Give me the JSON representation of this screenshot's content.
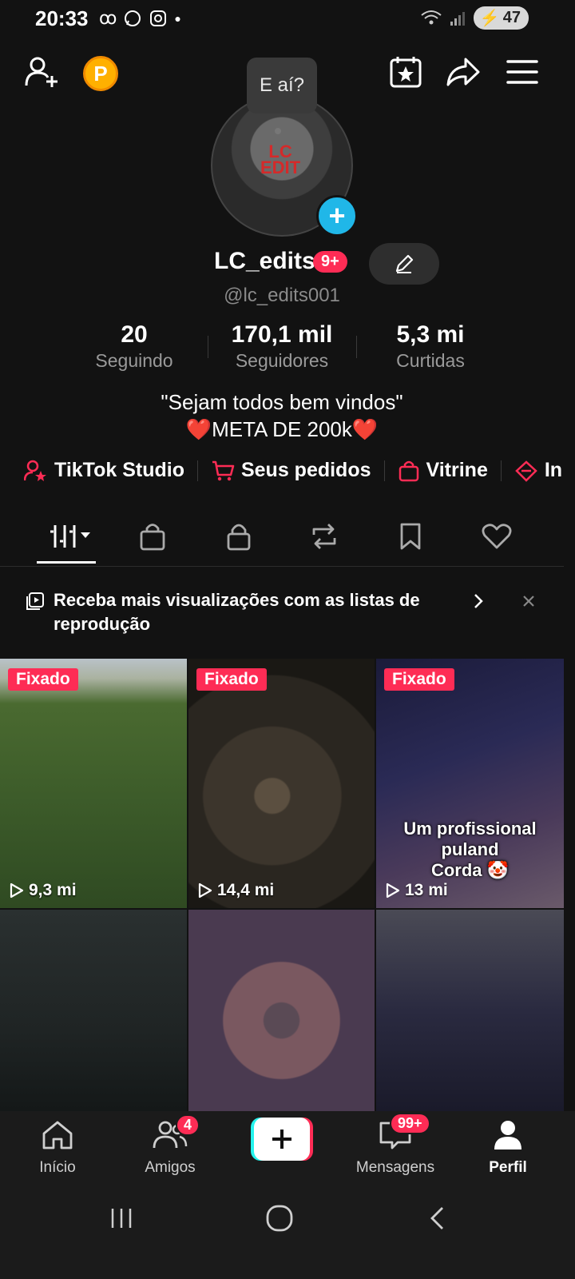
{
  "status": {
    "time": "20:33",
    "battery": "47"
  },
  "tooltip": "E aí?",
  "avatar": {
    "label_line1": "LC",
    "label_line2": "EDIT"
  },
  "profile": {
    "name": "LC_edits",
    "name_badge": "9+",
    "handle": "@lc_edits001"
  },
  "stats": [
    {
      "value": "20",
      "label": "Seguindo"
    },
    {
      "value": "170,1 mil",
      "label": "Seguidores"
    },
    {
      "value": "5,3 mi",
      "label": "Curtidas"
    }
  ],
  "bio": {
    "line1": "\"Sejam todos bem vindos\"",
    "line2": "❤️META DE 200k❤️"
  },
  "links": [
    {
      "label": "TikTok Studio",
      "icon": "person-star-icon"
    },
    {
      "label": "Seus pedidos",
      "icon": "cart-icon"
    },
    {
      "label": "Vitrine",
      "icon": "bag-icon"
    },
    {
      "label": "In",
      "icon": "gift-icon"
    }
  ],
  "banner": {
    "text": "Receba mais visualizações com as listas de reprodução"
  },
  "videos": [
    {
      "pinned": "Fixado",
      "views": "9,3 mi"
    },
    {
      "pinned": "Fixado",
      "views": "14,4 mi"
    },
    {
      "pinned": "Fixado",
      "views": "13 mi",
      "caption_line1": "Um profissional puland",
      "caption_line2": "Corda 🤡"
    },
    {},
    {},
    {}
  ],
  "nav": {
    "home": "Início",
    "friends": "Amigos",
    "friends_badge": "4",
    "messages": "Mensagens",
    "messages_badge": "99+",
    "profile": "Perfil"
  },
  "colors": {
    "accent": "#fe2c55",
    "avatar_plus": "#20b7e8",
    "coin": "#ffb000"
  }
}
